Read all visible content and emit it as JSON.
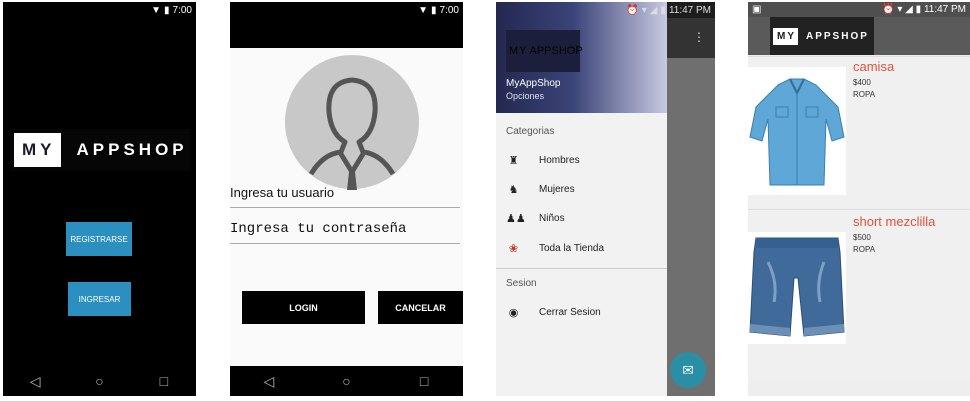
{
  "screen1": {
    "status_time": "7:00",
    "logo_my": "MY",
    "logo_shop": "APPSHOP",
    "register_label": "REGISTRARSE",
    "login_label": "INGRESAR"
  },
  "screen2": {
    "status_time": "7:00",
    "username_placeholder": "Ingresa tu usuario",
    "password_placeholder": "Ingresa tu contraseña",
    "login_label": "LOGIN",
    "cancel_label": "CANCELAR"
  },
  "screen3": {
    "status_time": "11:47 PM",
    "logo_my": "MY",
    "logo_shop": "APPSHOP",
    "app_name": "MyAppShop",
    "subtitle": "Opciones",
    "categories_header": "Categorias",
    "items": [
      {
        "label": "Hombres",
        "icon": "man-icon"
      },
      {
        "label": "Mujeres",
        "icon": "woman-icon"
      },
      {
        "label": "Niños",
        "icon": "kids-icon"
      },
      {
        "label": "Toda la Tienda",
        "icon": "store-icon"
      }
    ],
    "session_header": "Sesion",
    "logout_label": "Cerrar Sesion"
  },
  "screen4": {
    "status_time": "11:47 PM",
    "logo_my": "MY",
    "logo_shop": "APPSHOP",
    "products": [
      {
        "name": "camisa",
        "price": "$400",
        "category": "ROPA"
      },
      {
        "name": "short mezclilla",
        "price": "$500",
        "category": "ROPA"
      }
    ]
  },
  "colors": {
    "accent_blue": "#2b8fbf",
    "product_title": "#e0533a",
    "fab": "#2a8fa6"
  }
}
